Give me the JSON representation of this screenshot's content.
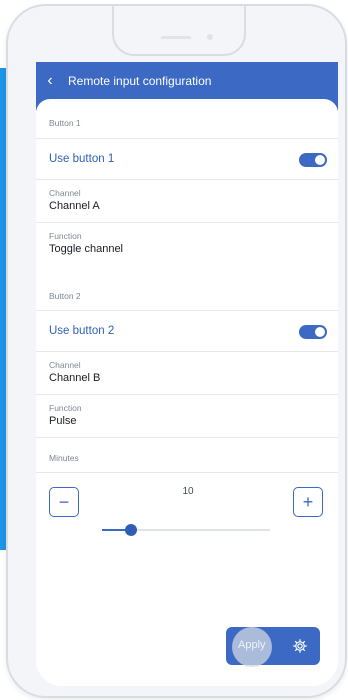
{
  "header": {
    "title": "Remote input configuration"
  },
  "button1": {
    "section_label": "Button 1",
    "use_label": "Use button 1",
    "toggle_on": true,
    "channel_caption": "Channel",
    "channel_value": "Channel A",
    "function_caption": "Function",
    "function_value": "Toggle channel"
  },
  "button2": {
    "section_label": "Button 2",
    "use_label": "Use button 2",
    "toggle_on": true,
    "channel_caption": "Channel",
    "channel_value": "Channel B",
    "function_caption": "Function",
    "function_value": "Pulse"
  },
  "minutes": {
    "label": "Minutes",
    "value": "10",
    "decrement_symbol": "−",
    "increment_symbol": "+",
    "slider_fraction": 0.17
  },
  "footer": {
    "apply_label": "Apply"
  },
  "icons": {
    "back": "chevron-left-icon",
    "settings": "gear-icon"
  },
  "colors": {
    "primary": "#3b69c3",
    "accent_panel": "#1f95e8",
    "text_primary": "#1a1d24",
    "text_muted": "#7d8591"
  }
}
